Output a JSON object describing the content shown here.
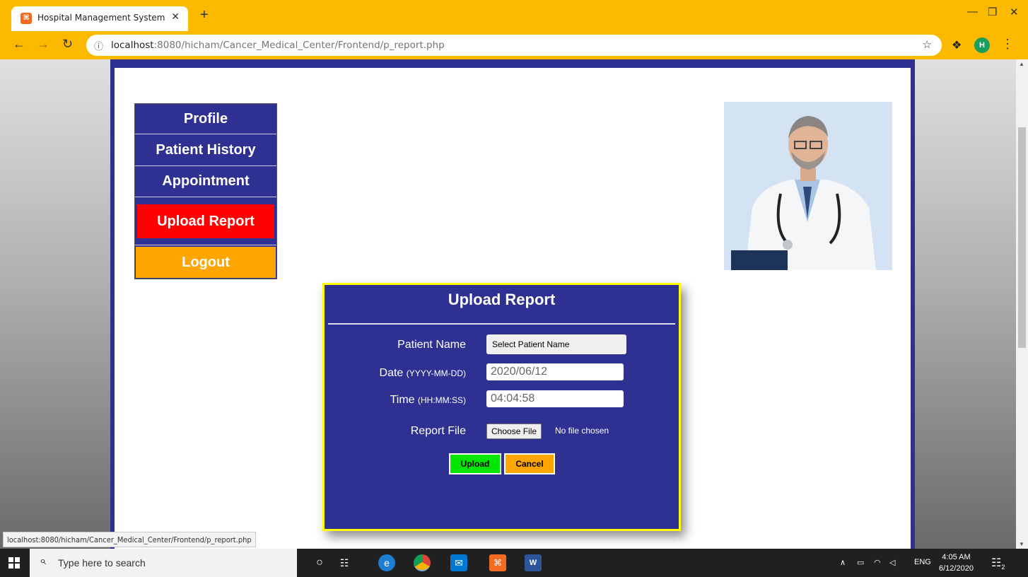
{
  "browser": {
    "tab_title": "Hospital Management System",
    "tab_favicon": "xampp-icon",
    "url_host": "localhost",
    "url_rest": ":8080/hicham/Cancer_Medical_Center/Frontend/p_report.php",
    "status_url": "localhost:8080/hicham/Cancer_Medical_Center/Frontend/p_report.php",
    "accent": "#fbb900"
  },
  "sidebar": {
    "items": [
      {
        "label": "Profile"
      },
      {
        "label": "Patient History"
      },
      {
        "label": "Appointment"
      },
      {
        "label": "Upload Report",
        "color": "#ff0000"
      },
      {
        "label": "Logout",
        "color": "#ffa500"
      }
    ],
    "bg": "#2e3192"
  },
  "modal": {
    "title": "Upload Report",
    "patient_label": "Patient Name",
    "patient_value": "Select Patient Name",
    "date_label": "Date",
    "date_hint": "(YYYY-MM-DD)",
    "date_value": "2020/06/12",
    "time_label": "Time",
    "time_hint": "(HH:MM:SS)",
    "time_value": "04:04:58",
    "file_label": "Report File",
    "choose_label": "Choose File",
    "no_file_text": "No file chosen",
    "upload_label": "Upload",
    "cancel_label": "Cancel",
    "border_color": "#ffff00"
  },
  "taskbar": {
    "search_placeholder": "Type here to search",
    "language": "ENG",
    "time": "4:05 AM",
    "date": "6/12/2020",
    "notification_count": "2"
  }
}
